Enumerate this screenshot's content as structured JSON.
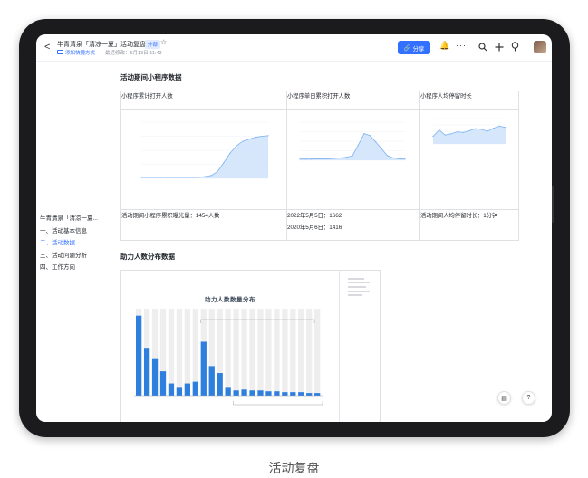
{
  "header": {
    "back_glyph": "<",
    "title": "牛青清泉「清凉一夏」活动复盘",
    "badge": "外部",
    "shortcut": "添加快捷方式",
    "modified": "最近修改：5月13日 11:43",
    "share_label": "分享"
  },
  "toc": [
    {
      "label": "牛青清泉「清凉一夏...",
      "active": false
    },
    {
      "label": "一、活动基本信息",
      "active": false
    },
    {
      "label": "二、活动数据",
      "active": true
    },
    {
      "label": "三、活动问题分析",
      "active": false
    },
    {
      "label": "四、工作方向",
      "active": false
    }
  ],
  "section1": {
    "title": "活动期间小程序数据",
    "headers": [
      "小程序累计打开人数",
      "小程序单日累积打开人数",
      "小程序人均停留时长"
    ],
    "row1": [
      "活动期间小程序累积曝光量：1454人数",
      "2022年5月5日：1662",
      "活动期间人均停留时长：1分钟"
    ],
    "row1_line2": "2020年5月6日：1416"
  },
  "section2": {
    "title": "助力人数分布数据",
    "chart_title": "助力人数数量分布"
  },
  "caption": "活动复盘",
  "icons": [
    "chevron-left-icon",
    "folder-icon",
    "star-icon",
    "link-icon",
    "bell-icon",
    "more-icon",
    "search-icon",
    "plus-icon",
    "pin-icon",
    "avatar",
    "doc-icon",
    "help-icon"
  ],
  "colors": {
    "accent": "#3370ff",
    "chart_fill": "#cfe3fb",
    "chart_line": "#7fb3f0",
    "bar_blue": "#2f7fde",
    "bar_bg": "#eeeeee"
  },
  "chart_data": [
    {
      "type": "area",
      "title": "小程序累计打开人数",
      "x": [
        0,
        1,
        2,
        3,
        4,
        5,
        6,
        7,
        8,
        9,
        10,
        11,
        12,
        13,
        14,
        15,
        16,
        17,
        18,
        19,
        20
      ],
      "values": [
        2,
        2,
        2,
        2,
        2,
        2,
        2,
        2,
        2,
        2,
        3,
        5,
        12,
        28,
        45,
        58,
        66,
        70,
        73,
        75,
        76
      ],
      "ylim": [
        0,
        100
      ]
    },
    {
      "type": "area",
      "title": "小程序单日累积打开人数",
      "x": [
        0,
        1,
        2,
        3,
        4,
        5,
        6,
        7,
        8,
        9,
        10,
        11,
        12,
        13,
        14,
        15,
        16,
        17,
        18
      ],
      "values": [
        3,
        3,
        3,
        4,
        3,
        4,
        5,
        6,
        8,
        12,
        40,
        70,
        65,
        48,
        30,
        12,
        6,
        4,
        3
      ],
      "ylim": [
        0,
        100
      ]
    },
    {
      "type": "area",
      "title": "小程序人均停留时长",
      "x": [
        0,
        1,
        2,
        3,
        4,
        5,
        6,
        7,
        8,
        9,
        10,
        11,
        12
      ],
      "values": [
        30,
        55,
        35,
        40,
        48,
        45,
        52,
        60,
        58,
        50,
        62,
        70,
        65
      ],
      "ylim": [
        0,
        100
      ]
    },
    {
      "type": "bar",
      "title": "助力人数数量分布",
      "values": [
        92,
        55,
        42,
        28,
        14,
        9,
        14,
        16,
        62,
        34,
        26,
        9,
        6,
        7,
        6,
        6,
        5,
        5,
        4,
        4,
        4,
        3,
        3
      ],
      "ylim": [
        0,
        100
      ]
    }
  ]
}
